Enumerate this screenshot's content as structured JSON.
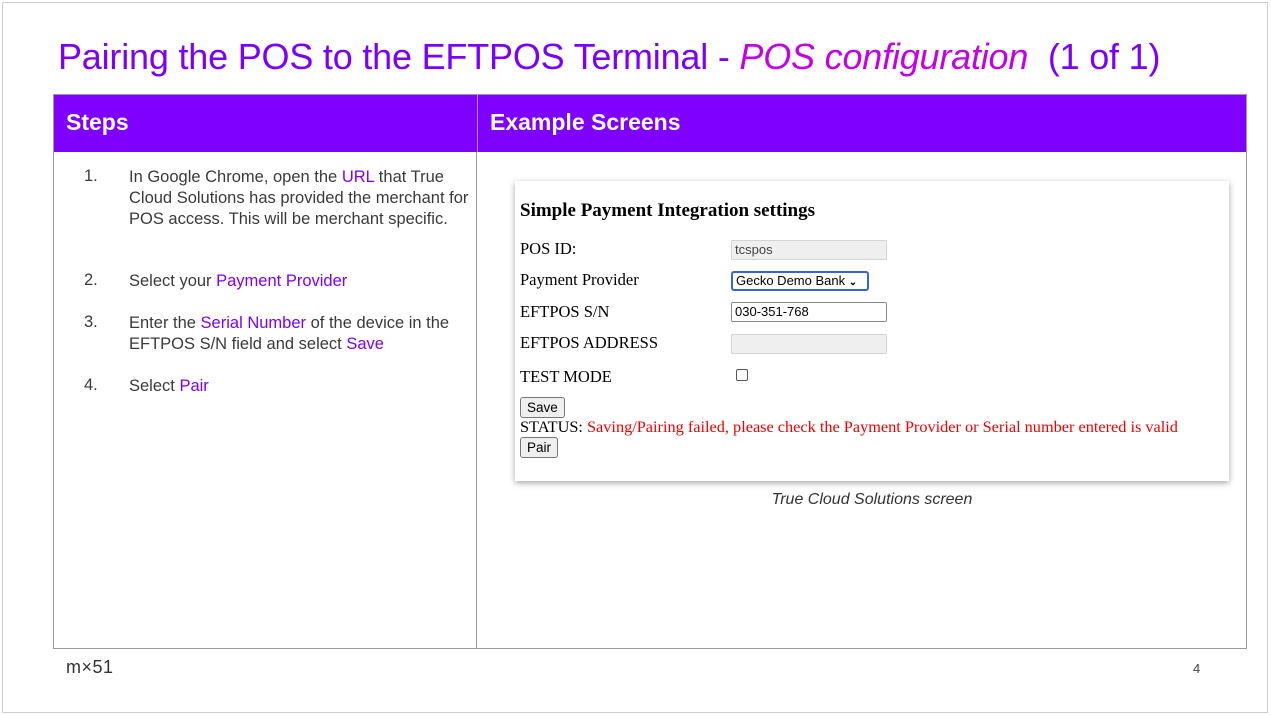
{
  "slide": {
    "title_main": "Pairing the POS to the EFTPOS Terminal - ",
    "title_emph": "POS configuration",
    "title_suffix": "(1 of 1)",
    "page_number": "4",
    "logo_text": "m×51"
  },
  "table": {
    "col1_header": "Steps",
    "col2_header": "Example Screens"
  },
  "steps": [
    {
      "num": "1.",
      "parts": [
        "In Google Chrome, open the ",
        "URL",
        " that True Cloud Solutions has provided the merchant for POS access. This will be merchant specific."
      ]
    },
    {
      "num": "2.",
      "parts": [
        "Select your ",
        "Payment Provider",
        ""
      ]
    },
    {
      "num": "3.",
      "parts": [
        "Enter the ",
        "Serial Number",
        " of the device in the EFTPOS S/N field and select ",
        "Save",
        ""
      ]
    },
    {
      "num": "4.",
      "parts": [
        "Select ",
        "Pair",
        ""
      ]
    }
  ],
  "screen": {
    "heading": "Simple Payment Integration settings",
    "pos_id_label": "POS ID:",
    "pos_id_value": "tcspos",
    "provider_label": "Payment Provider",
    "provider_value": "Gecko Demo Bank",
    "sn_label": "EFTPOS S/N",
    "sn_value": "030-351-768",
    "address_label": "EFTPOS ADDRESS",
    "address_value": "",
    "test_mode_label": "TEST MODE",
    "test_mode_checked": false,
    "save_label": "Save",
    "status_label": "STATUS: ",
    "status_message": "Saving/Pairing failed, please check the Payment Provider or Serial number entered is valid",
    "pair_label": "Pair"
  },
  "caption": "True Cloud Solutions screen",
  "colors": {
    "accent": "#7f00ff",
    "emphasis": "#c400e6",
    "error": "#ee0000"
  }
}
